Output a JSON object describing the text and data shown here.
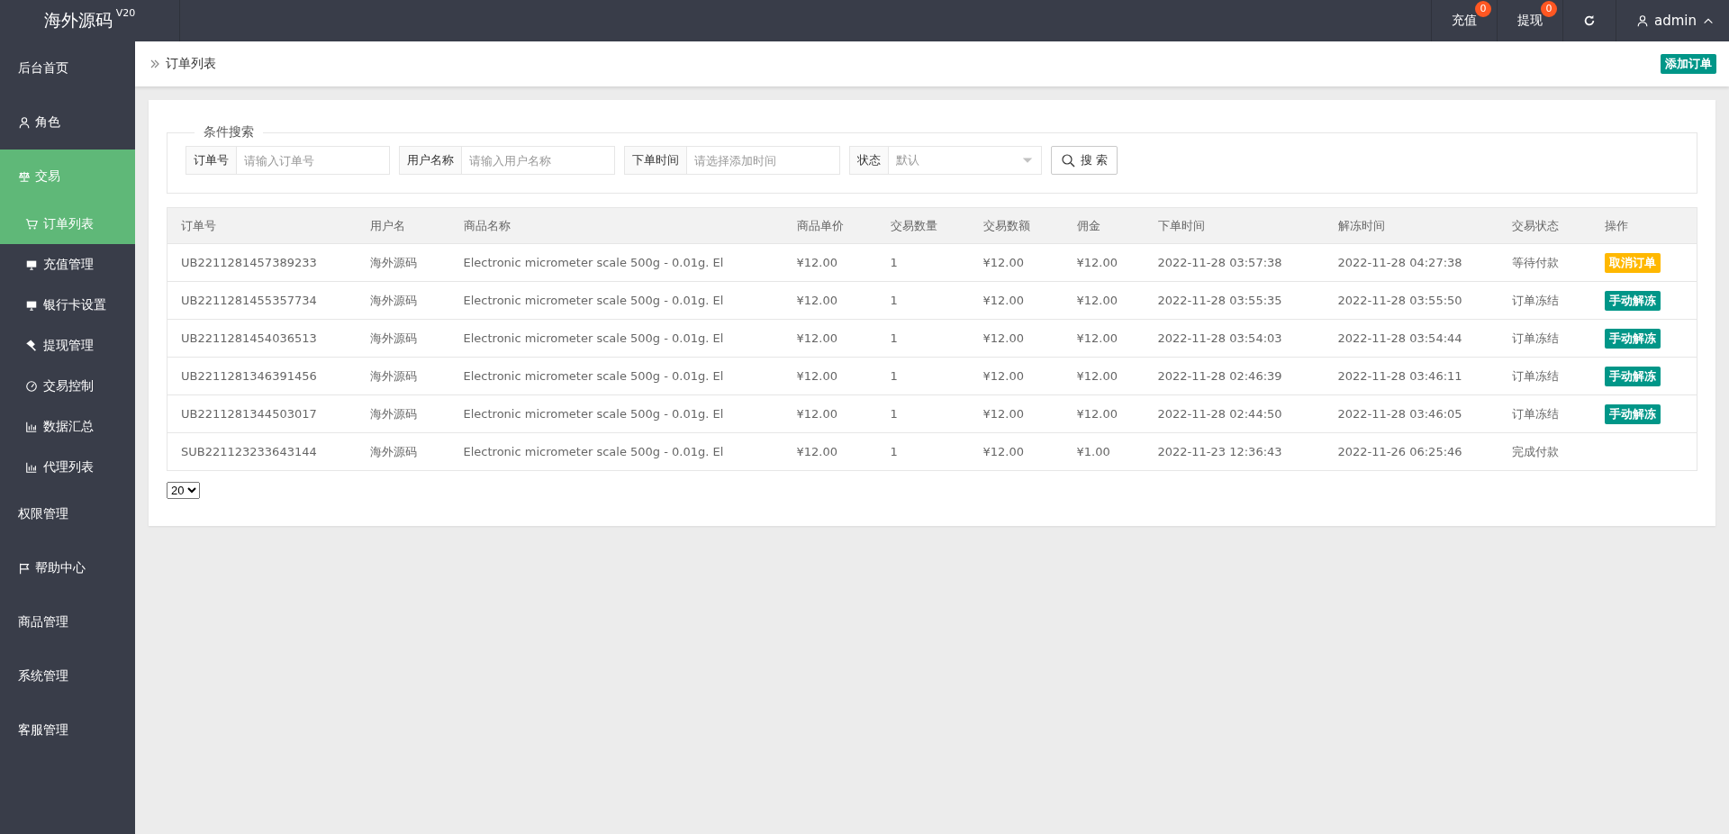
{
  "topbar": {
    "logo": "海外源码",
    "version": "V20",
    "actions": [
      {
        "kind": "link",
        "label": "充值",
        "badge": "0"
      },
      {
        "kind": "link",
        "label": "提现",
        "badge": "0"
      },
      {
        "kind": "refresh"
      }
    ],
    "user": "admin"
  },
  "sidebar": {
    "items": [
      {
        "label": "后台首页",
        "selected": false
      },
      {
        "label": "角色",
        "selected": false
      },
      {
        "label": "交易",
        "selected": false,
        "expanded": true,
        "children": [
          {
            "label": "订单列表",
            "selected": true
          },
          {
            "label": "充值管理",
            "selected": false
          },
          {
            "label": "银行卡设置",
            "selected": false
          },
          {
            "label": "提现管理",
            "selected": false
          },
          {
            "label": "交易控制",
            "selected": false
          },
          {
            "label": "数据汇总",
            "selected": false
          },
          {
            "label": "代理列表",
            "selected": false
          }
        ]
      },
      {
        "label": "权限管理",
        "selected": false
      },
      {
        "label": "帮助中心",
        "selected": false
      },
      {
        "label": "商品管理",
        "selected": false
      },
      {
        "label": "系统管理",
        "selected": false
      },
      {
        "label": "客服管理",
        "selected": false
      }
    ]
  },
  "breadcrumb": "订单列表",
  "add_button": "添加订单",
  "search": {
    "legend": "条件搜索",
    "fields": [
      {
        "kind": "input",
        "label": "订单号",
        "placeholder": "请输入订单号"
      },
      {
        "kind": "input",
        "label": "用户名称",
        "placeholder": "请输入用户名称"
      },
      {
        "kind": "input",
        "label": "下单时间",
        "placeholder": "请选择添加时间"
      },
      {
        "kind": "select",
        "label": "状态",
        "value": "默认"
      }
    ],
    "button": "搜 索"
  },
  "table": {
    "columns": [
      "订单号",
      "用户名",
      "商品名称",
      "商品单价",
      "交易数量",
      "交易数额",
      "佣金",
      "下单时间",
      "解冻时间",
      "交易状态",
      "操作"
    ],
    "rows": [
      {
        "cells": [
          "UB2211281457389233",
          "海外源码",
          "Electronic micrometer scale 500g - 0.01g. El",
          "¥12.00",
          "1",
          "¥12.00",
          "¥12.00",
          "2022-11-28 03:57:38",
          "2022-11-28 04:27:38",
          "等待付款"
        ],
        "action": {
          "kind": "warning",
          "label": "取消订单"
        }
      },
      {
        "cells": [
          "UB2211281455357734",
          "海外源码",
          "Electronic micrometer scale 500g - 0.01g. El",
          "¥12.00",
          "1",
          "¥12.00",
          "¥12.00",
          "2022-11-28 03:55:35",
          "2022-11-28 03:55:50",
          "订单冻结"
        ],
        "action": {
          "kind": "primary",
          "label": "手动解冻"
        }
      },
      {
        "cells": [
          "UB2211281454036513",
          "海外源码",
          "Electronic micrometer scale 500g - 0.01g. El",
          "¥12.00",
          "1",
          "¥12.00",
          "¥12.00",
          "2022-11-28 03:54:03",
          "2022-11-28 03:54:44",
          "订单冻结"
        ],
        "action": {
          "kind": "primary",
          "label": "手动解冻"
        }
      },
      {
        "cells": [
          "UB2211281346391456",
          "海外源码",
          "Electronic micrometer scale 500g - 0.01g. El",
          "¥12.00",
          "1",
          "¥12.00",
          "¥12.00",
          "2022-11-28 02:46:39",
          "2022-11-28 03:46:11",
          "订单冻结"
        ],
        "action": {
          "kind": "primary",
          "label": "手动解冻"
        }
      },
      {
        "cells": [
          "UB2211281344503017",
          "海外源码",
          "Electronic micrometer scale 500g - 0.01g. El",
          "¥12.00",
          "1",
          "¥12.00",
          "¥12.00",
          "2022-11-28 02:44:50",
          "2022-11-28 03:46:05",
          "订单冻结"
        ],
        "action": {
          "kind": "primary",
          "label": "手动解冻"
        }
      },
      {
        "cells": [
          "SUB221123233643144",
          "海外源码",
          "Electronic micrometer scale 500g - 0.01g. El",
          "¥12.00",
          "1",
          "¥12.00",
          "¥1.00",
          "2022-11-23 12:36:43",
          "2022-11-26 06:25:46",
          "完成付款"
        ]
      }
    ]
  },
  "page_size": "20"
}
